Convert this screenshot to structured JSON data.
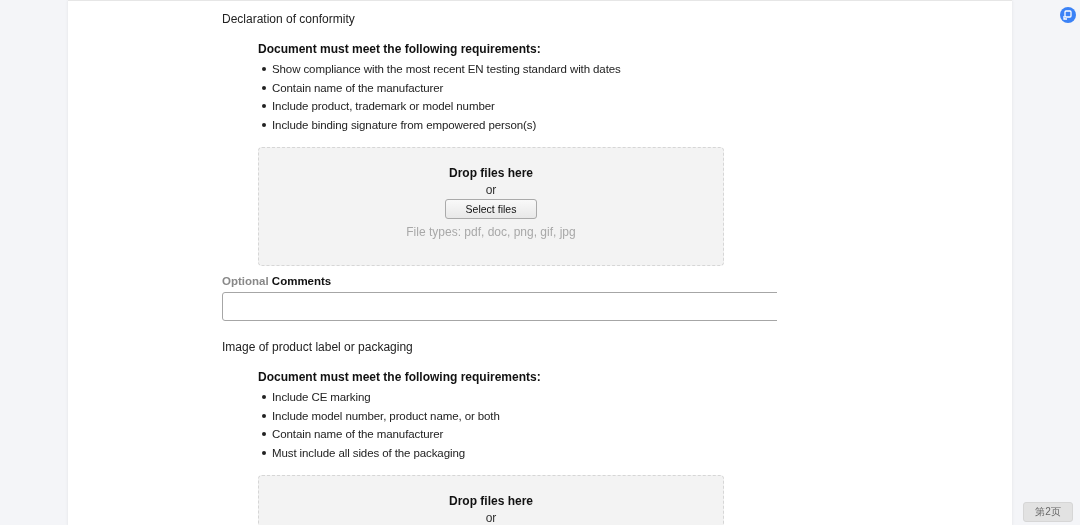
{
  "sections": [
    {
      "kind": "upload",
      "title": "Declaration of conformity",
      "requirements_heading": "Document must meet the following requirements:",
      "requirements": [
        "Show compliance with the most recent EN testing standard with dates",
        "Contain name of the manufacturer",
        "Include product, trademark or model number",
        "Include binding signature from empowered person(s)"
      ],
      "dropzone": {
        "heading": "Drop files here",
        "or": "or",
        "button": "Select files",
        "file_types": "File types: pdf, doc, png, gif, jpg"
      }
    },
    {
      "kind": "comments",
      "optional": "Optional",
      "label": "Comments"
    },
    {
      "kind": "upload",
      "title": "Image of product label or packaging",
      "requirements_heading": "Document must meet the following requirements:",
      "requirements": [
        "Include CE marking",
        "Include model number, product name, or both",
        "Contain name of the manufacturer",
        "Must include all sides of the packaging"
      ],
      "dropzone": {
        "heading": "Drop files here",
        "or": "or"
      }
    }
  ],
  "page_button": "第2页"
}
